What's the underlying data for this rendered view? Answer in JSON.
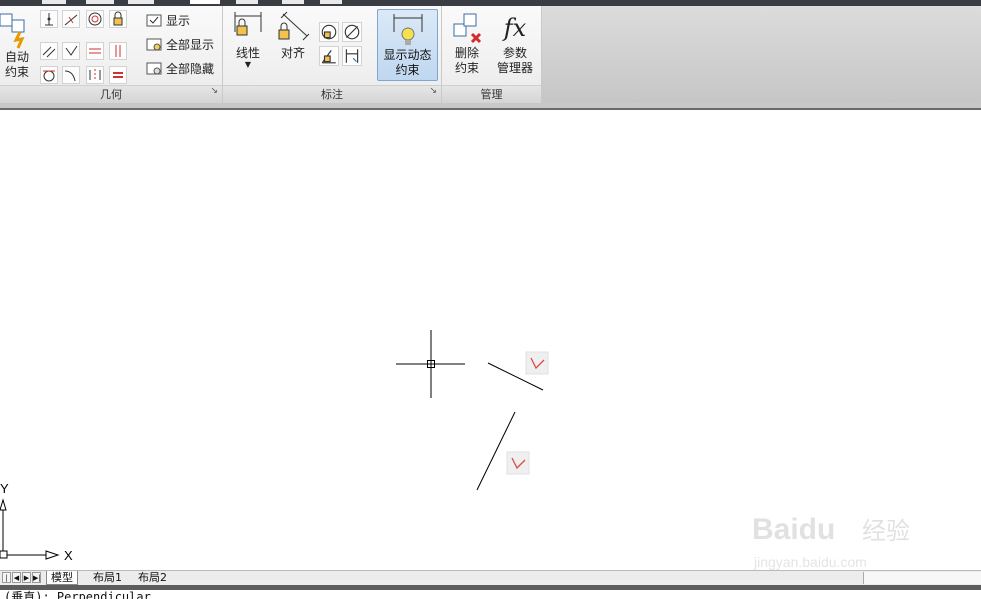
{
  "ribbon": {
    "panels": {
      "geometric": {
        "title": "几何",
        "auto_constrain_label_line1": "自动",
        "auto_constrain_label_line2": "约束",
        "show_label": "显示",
        "show_all_label": "全部显示",
        "hide_all_label": "全部隐藏"
      },
      "dimensional": {
        "title": "标注",
        "linear_label": "线性",
        "aligned_label": "对齐",
        "show_dynamic_label_line1": "显示动态",
        "show_dynamic_label_line2": "约束"
      },
      "manage": {
        "title": "管理",
        "delete_label_line1": "删除",
        "delete_label_line2": "约束",
        "params_label_line1": "参数",
        "params_label_line2": "管理器",
        "fx_glyph": "fx"
      }
    }
  },
  "ucs": {
    "x_label": "X",
    "y_label": "Y"
  },
  "layout_tabs": [
    "模型",
    "布局1",
    "布局2"
  ],
  "command_line": "(垂直): Perpendicular",
  "watermark": {
    "brand": "Baidu",
    "brand_cn": "经验",
    "url": "jingyan.baidu.com"
  },
  "colors": {
    "accent": "#bfd7f0",
    "constraint_icon": "#d94b4b"
  }
}
